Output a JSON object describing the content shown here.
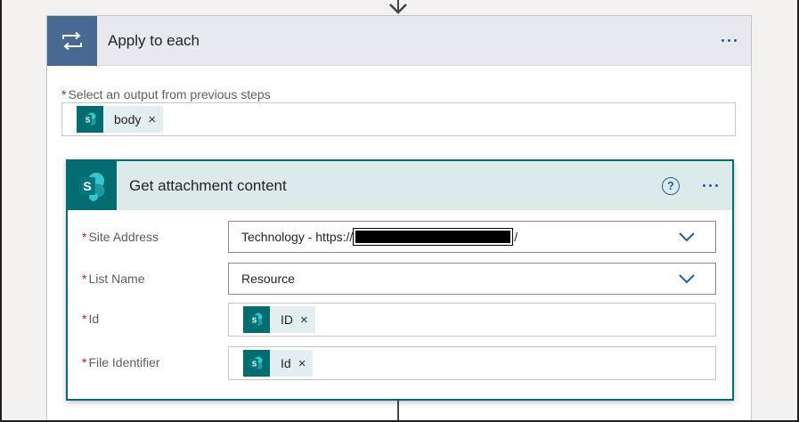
{
  "apply_to_each": {
    "title": "Apply to each",
    "icon": "loop-icon",
    "output_label": "Select an output from previous steps",
    "required_mark": "*",
    "output_token": {
      "label": "body",
      "remove": "×",
      "icon": "sharepoint-icon"
    }
  },
  "action": {
    "title": "Get attachment content",
    "icon": "sharepoint-icon",
    "help": "?",
    "fields": {
      "site_address": {
        "label": "Site Address",
        "value_prefix": "Technology - https://",
        "value_suffix": "/"
      },
      "list_name": {
        "label": "List Name",
        "value": "Resource"
      },
      "id": {
        "label": "Id",
        "token": "ID",
        "remove": "×"
      },
      "file_identifier": {
        "label": "File Identifier",
        "token": "Id",
        "remove": "×"
      }
    }
  },
  "colors": {
    "sharepoint_teal": "#036c70",
    "loop_blue": "#486991",
    "link_blue": "#1f5fa8",
    "required_red": "#a4262c"
  }
}
